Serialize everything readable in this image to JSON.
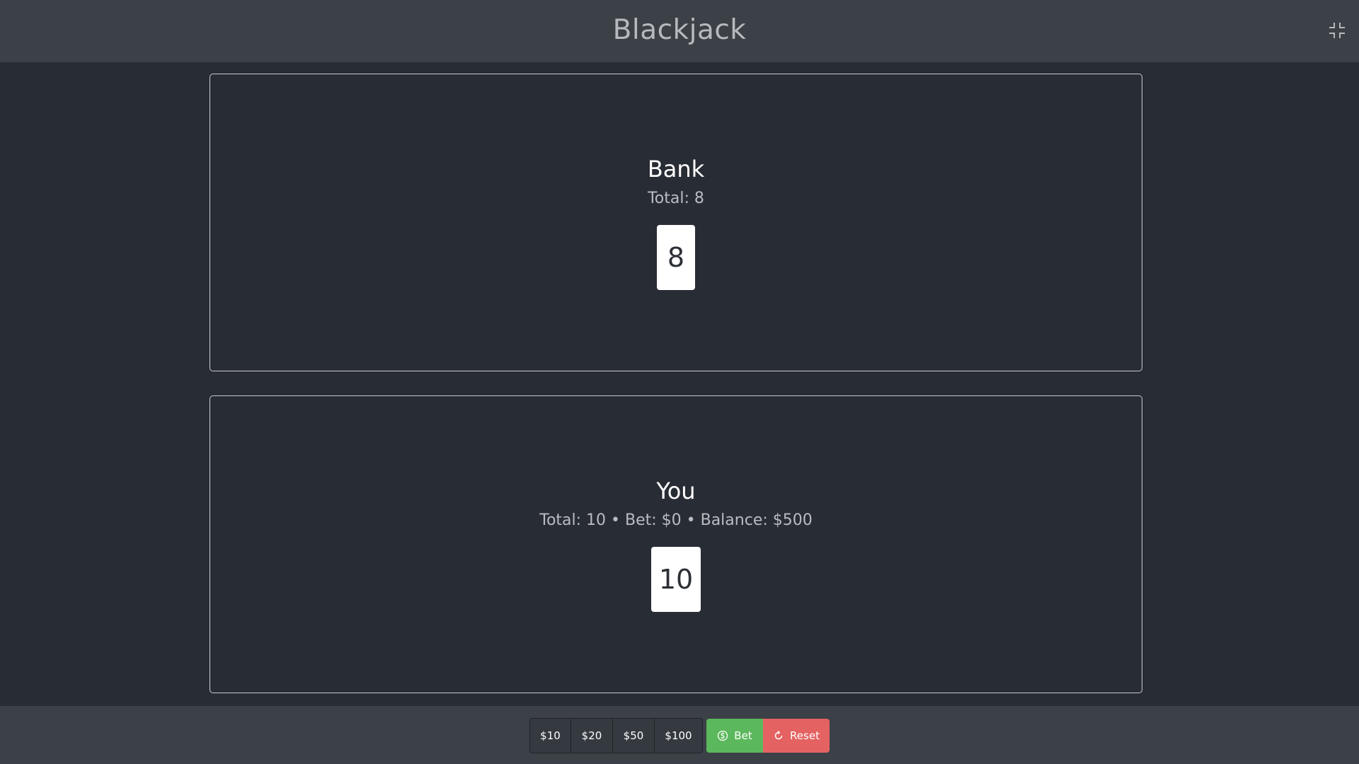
{
  "header": {
    "title": "Blackjack",
    "fullscreen_icon": "exit-fullscreen-icon"
  },
  "bank": {
    "name": "Bank",
    "info": "Total: 8",
    "cards": [
      "8"
    ]
  },
  "player": {
    "name": "You",
    "info": "Total: 10 • Bet: $0 • Balance: $500",
    "cards": [
      "10"
    ]
  },
  "controls": {
    "chips": [
      "$10",
      "$20",
      "$50",
      "$100"
    ],
    "bet_label": "Bet",
    "bet_icon": "dollar-coin-icon",
    "reset_label": "Reset",
    "reset_icon": "refresh-icon"
  },
  "colors": {
    "background": "#282c34",
    "bar": "#3c4047",
    "bet": "#5cb85c",
    "reset": "#e46262"
  }
}
